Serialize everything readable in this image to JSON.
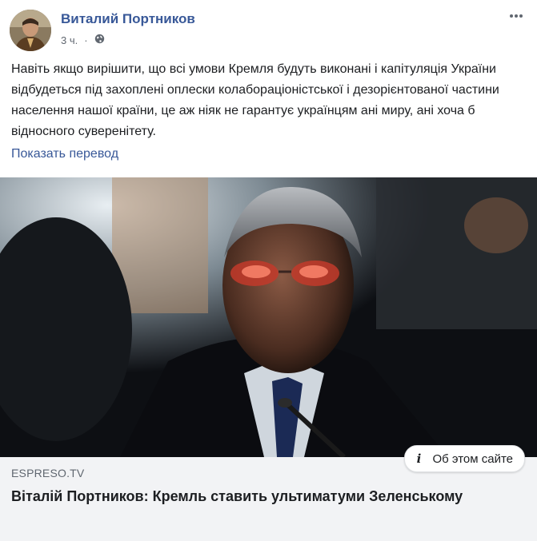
{
  "post": {
    "author": "Виталий Портников",
    "time": "3 ч.",
    "privacy_icon": "globe-icon",
    "more_icon": "more-dots-icon",
    "text": "Навіть якщо вирішити, що всі умови Кремля будуть виконані і капітуляція України відбудеться під захоплені оплески колабораціоністської і дезорієнтованої частини населення нашої країни, це аж ніяк не гарантує українцям ані миру, ані хоча б відносного суверенітету.",
    "translate_label": "Показать перевод"
  },
  "link": {
    "about_label": "Об этом сайте",
    "domain": "ESPRESO.TV",
    "title": "Віталій Портников: Кремль ставить ультиматуми Зеленському"
  },
  "colors": {
    "link_blue": "#385898",
    "card_bg": "#f2f3f5",
    "meta_gray": "#606770"
  }
}
